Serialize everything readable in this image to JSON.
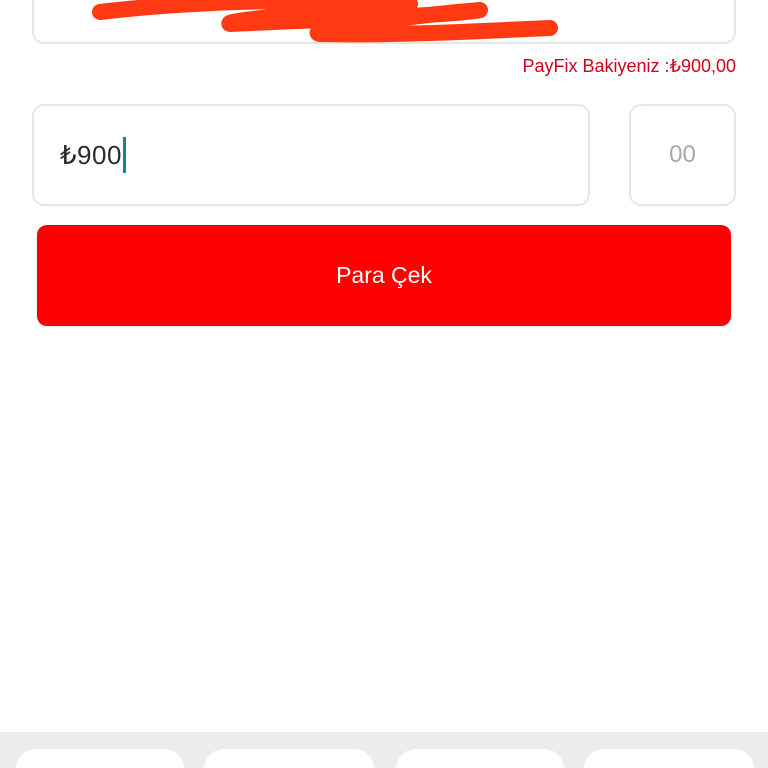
{
  "account": {
    "value_redacted": true
  },
  "balance": {
    "label": "PayFix Bakiyeniz :₺900,00"
  },
  "amount": {
    "value": "₺900"
  },
  "cents": {
    "placeholder": "00"
  },
  "withdraw_button": {
    "label": "Para Çek"
  },
  "colors": {
    "accent": "#ff0000",
    "balance_text": "#d0021b",
    "caret": "#15897a",
    "redaction": "#ff3a12"
  },
  "bottom_tray": {
    "chip_count_visible": 4
  }
}
